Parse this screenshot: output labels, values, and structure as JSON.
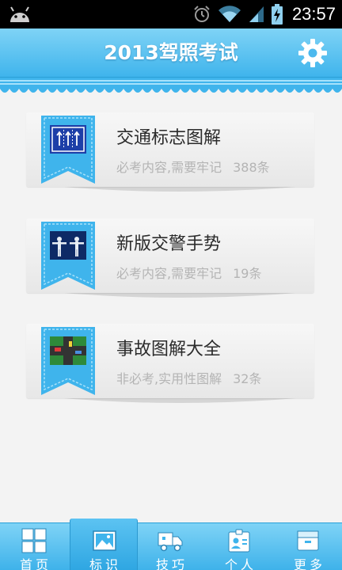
{
  "status_bar": {
    "time": "23:57",
    "icons": [
      "android-icon",
      "alarm-icon",
      "wifi-icon",
      "signal-icon",
      "battery-charging-icon"
    ]
  },
  "header": {
    "title": "2013驾照考试",
    "settings_icon": "gear-icon"
  },
  "categories": [
    {
      "title": "交通标志图解",
      "description": "必考内容,需要牢记",
      "count": "388条",
      "icon": "traffic-sign-icon"
    },
    {
      "title": "新版交警手势",
      "description": "必考内容,需要牢记",
      "count": "19条",
      "icon": "police-gesture-icon"
    },
    {
      "title": "事故图解大全",
      "description": "非必考,实用性图解",
      "count": "32条",
      "icon": "accident-diagram-icon"
    }
  ],
  "bottom_nav": {
    "active": "标识",
    "tabs": [
      {
        "label": "首页",
        "icon": "home-grid-icon"
      },
      {
        "label": "标识",
        "icon": "image-icon"
      },
      {
        "label": "技巧",
        "icon": "truck-icon"
      },
      {
        "label": "个人",
        "icon": "id-badge-icon"
      },
      {
        "label": "更多",
        "icon": "box-icon"
      }
    ]
  },
  "colors": {
    "primary": "#3fb4ec",
    "light": "#7fd3f6",
    "card": "#eeeeee",
    "text": "#2b2b2b",
    "subtext": "#b4b4b4"
  }
}
